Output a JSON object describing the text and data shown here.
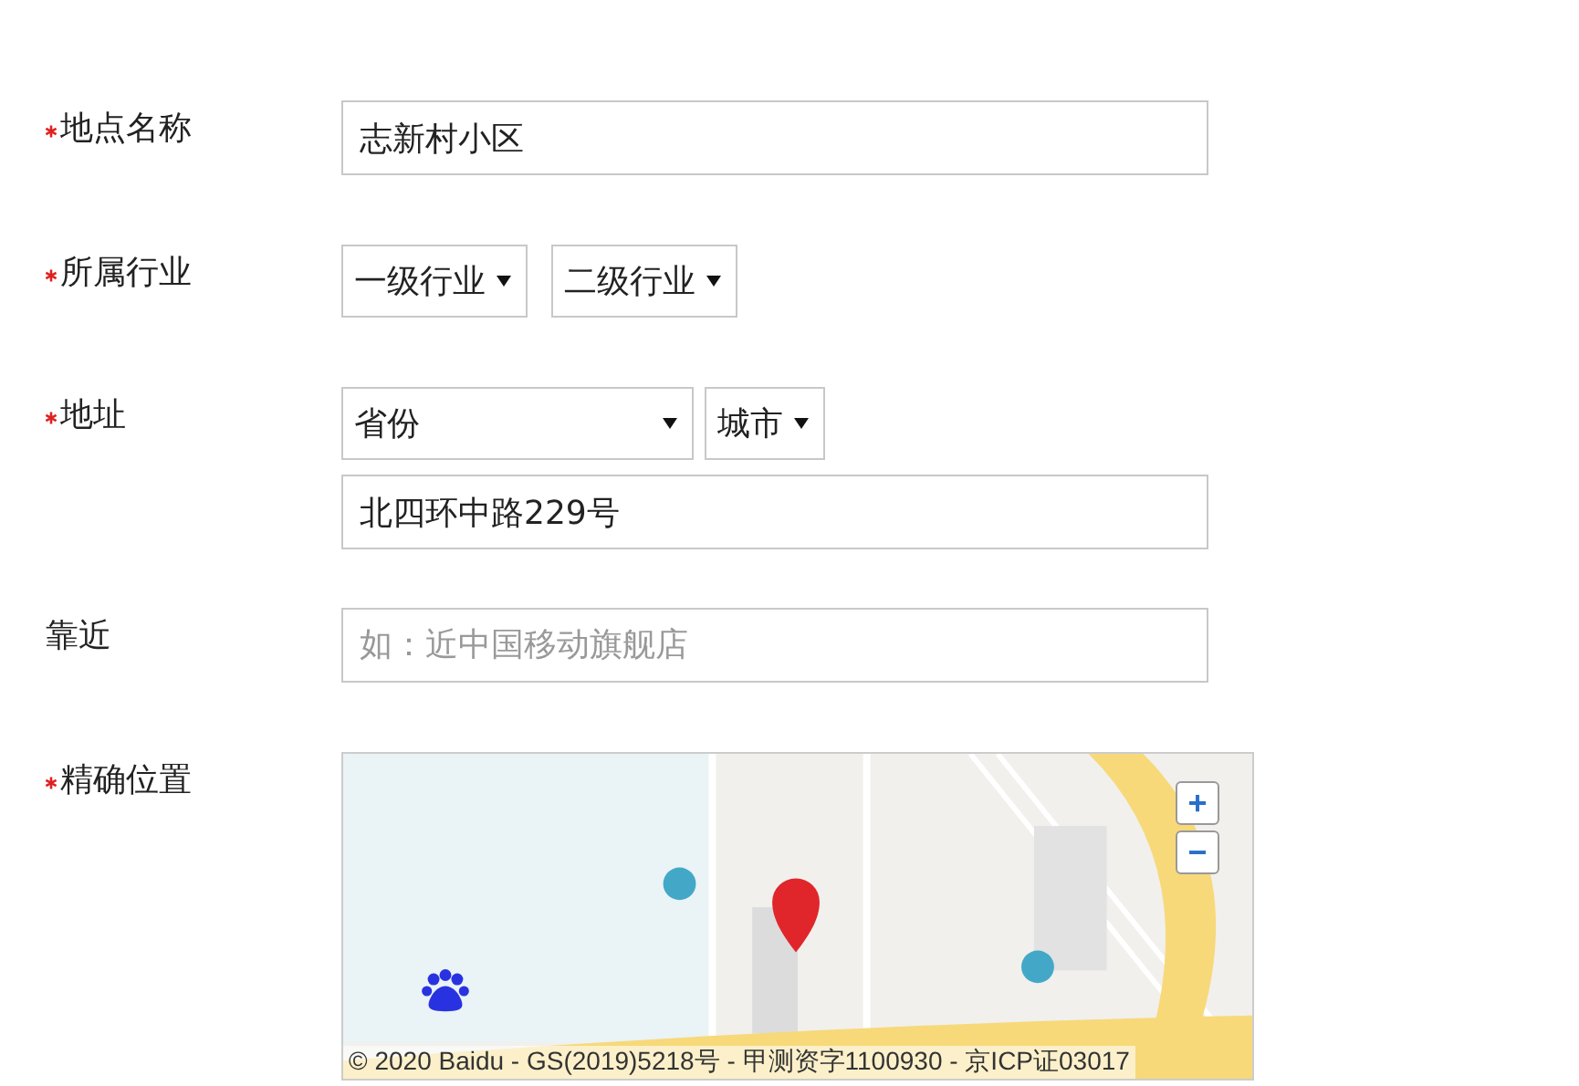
{
  "fields": [
    {
      "kind": "text",
      "label": "地点名称",
      "required": true,
      "value": "志新村小区"
    },
    {
      "kind": "selects",
      "label": "所属行业",
      "required": true,
      "selects": [
        {
          "value": "一级行业"
        },
        {
          "value": "二级行业"
        }
      ]
    },
    {
      "kind": "address",
      "label": "地址",
      "required": true,
      "selects": [
        {
          "value": "省份"
        },
        {
          "value": "城市"
        }
      ],
      "value": "北四环中路229号"
    },
    {
      "kind": "text",
      "label": "靠近",
      "required": false,
      "placeholder": "如：近中国移动旗舰店"
    },
    {
      "kind": "map",
      "label": "精确位置",
      "required": true,
      "zoom_in": "+",
      "zoom_out": "−",
      "copyright": "© 2020 Baidu - GS(2019)5218号 - 甲测资字1100930 - 京ICP证03017"
    }
  ]
}
